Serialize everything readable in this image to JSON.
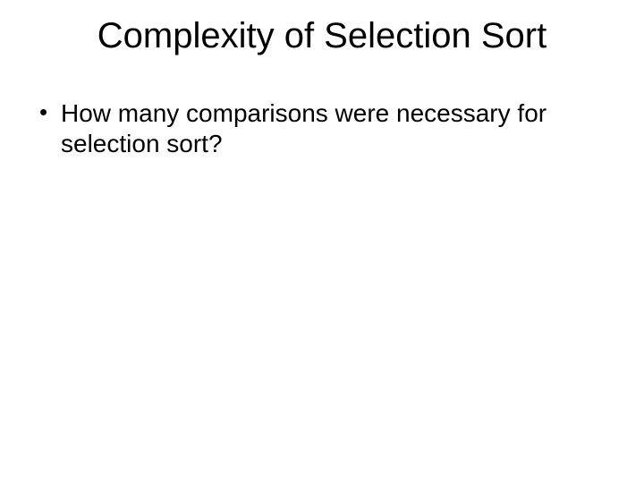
{
  "slide": {
    "title": "Complexity of Selection Sort",
    "bullets": [
      "How many comparisons were necessary for selection sort?"
    ]
  }
}
